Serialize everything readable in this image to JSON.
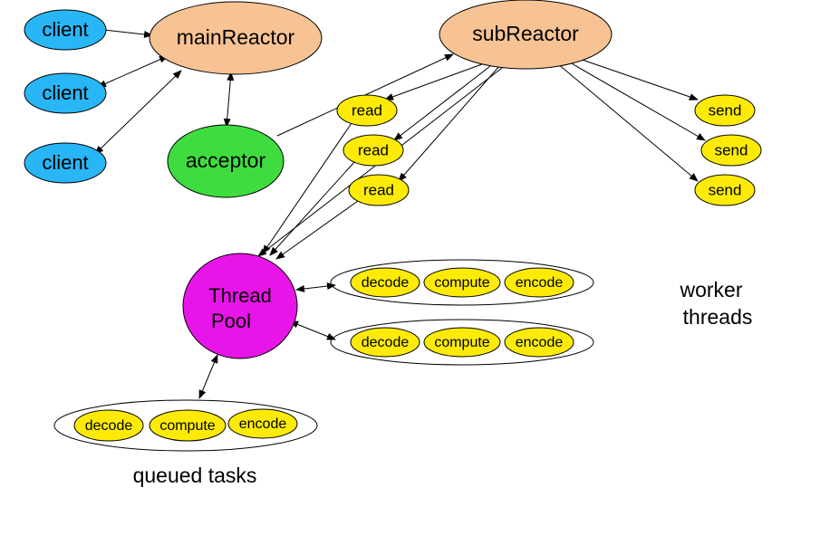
{
  "nodes": {
    "client1": "client",
    "client2": "client",
    "client3": "client",
    "mainReactor": "mainReactor",
    "subReactor": "subReactor",
    "acceptor": "acceptor",
    "read1": "read",
    "read2": "read",
    "read3": "read",
    "send1": "send",
    "send2": "send",
    "send3": "send",
    "threadPool1": "Thread",
    "threadPool2": "Pool",
    "decode1": "decode",
    "compute1": "compute",
    "encode1": "encode",
    "decode2": "decode",
    "compute2": "compute",
    "encode2": "encode",
    "decode3": "decode",
    "compute3": "compute",
    "encode3": "encode"
  },
  "labels": {
    "workerThreads1": "worker",
    "workerThreads2": "threads",
    "queuedTasks": "queued tasks"
  },
  "colors": {
    "client": "#29b6f6",
    "reactor": "#f7c394",
    "acceptor": "#3fdc3f",
    "yellow": "#fdeb07",
    "threadPool": "#e815e8",
    "stroke": "#000000"
  }
}
